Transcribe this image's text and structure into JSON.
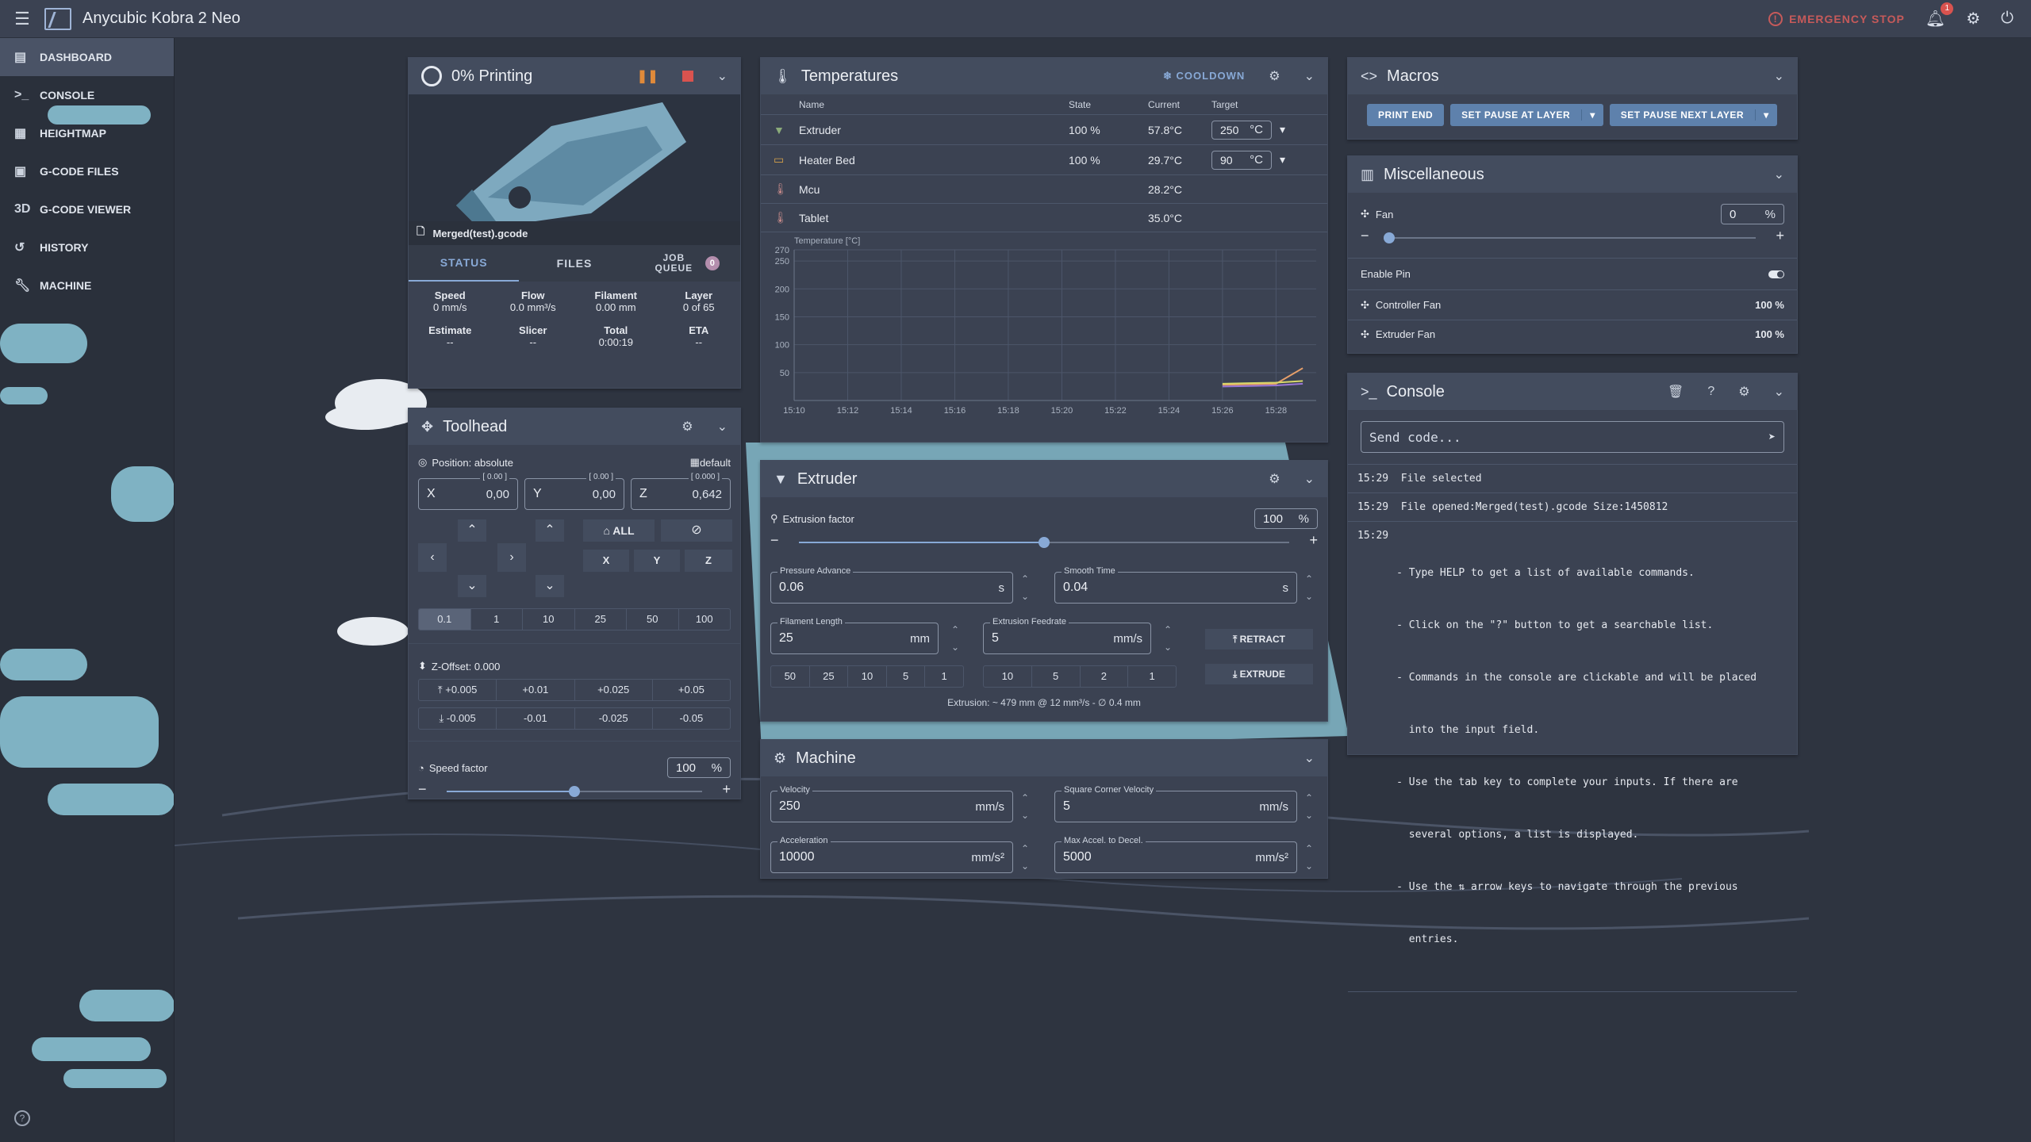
{
  "app": {
    "title": "Anycubic Kobra 2 Neo",
    "emergency": "EMERGENCY STOP",
    "notif_count": "1"
  },
  "nav": [
    {
      "label": "DASHBOARD",
      "icon": "dashboard-icon"
    },
    {
      "label": "CONSOLE",
      "icon": "console-icon"
    },
    {
      "label": "HEIGHTMAP",
      "icon": "grid-icon"
    },
    {
      "label": "G-CODE FILES",
      "icon": "files-icon"
    },
    {
      "label": "G-CODE VIEWER",
      "icon": "3d-icon",
      "glyph": "3D"
    },
    {
      "label": "HISTORY",
      "icon": "history-icon"
    },
    {
      "label": "MACHINE",
      "icon": "wrench-icon"
    }
  ],
  "status": {
    "title": "0% Printing",
    "filename": "Merged(test).gcode",
    "tabs": [
      "STATUS",
      "FILES",
      "JOB QUEUE"
    ],
    "queue_count": "0",
    "stats": [
      {
        "label": "Speed",
        "value": "0 mm/s"
      },
      {
        "label": "Flow",
        "value": "0.0 mm³/s"
      },
      {
        "label": "Filament",
        "value": "0.00 mm"
      },
      {
        "label": "Layer",
        "value": "0 of 65"
      },
      {
        "label": "Estimate",
        "value": "--"
      },
      {
        "label": "Slicer",
        "value": "--"
      },
      {
        "label": "Total",
        "value": "0:00:19"
      },
      {
        "label": "ETA",
        "value": "--"
      }
    ]
  },
  "toolhead": {
    "title": "Toolhead",
    "position_mode": "Position: absolute",
    "profile": "default",
    "axes": [
      {
        "axis": "X",
        "value": "0,00",
        "limit": "[ 0.00 ]"
      },
      {
        "axis": "Y",
        "value": "0,00",
        "limit": "[ 0.00 ]"
      },
      {
        "axis": "Z",
        "value": "0,642",
        "limit": "[ 0.000 ]"
      }
    ],
    "home_all": "ALL",
    "home_axes": [
      "X",
      "Y",
      "Z"
    ],
    "steps": [
      "0.1",
      "1",
      "10",
      "25",
      "50",
      "100"
    ],
    "zoffset": "Z-Offset: 0.000",
    "zup": [
      "+0.005",
      "+0.01",
      "+0.025",
      "+0.05"
    ],
    "zdown": [
      "-0.005",
      "-0.01",
      "-0.025",
      "-0.05"
    ],
    "speed_label": "Speed factor",
    "speed_value": "100",
    "speed_unit": "%",
    "speed_fraction": 0.5
  },
  "temps": {
    "title": "Temperatures",
    "cooldown": "COOLDOWN",
    "headers": [
      "Name",
      "State",
      "Current",
      "Target"
    ],
    "rows": [
      {
        "name": "Extruder",
        "state": "100 %",
        "current": "57.8°C",
        "target": "250",
        "unit": "°C"
      },
      {
        "name": "Heater Bed",
        "state": "100 %",
        "current": "29.7°C",
        "target": "90",
        "unit": "°C"
      },
      {
        "name": "Mcu",
        "state": "",
        "current": "28.2°C",
        "target": "",
        "unit": ""
      },
      {
        "name": "Tablet",
        "state": "",
        "current": "35.0°C",
        "target": "",
        "unit": ""
      }
    ]
  },
  "chart_data": {
    "type": "line",
    "ylabel": "Temperature [°C]",
    "ylim": [
      0,
      270
    ],
    "yticks": [
      50,
      100,
      150,
      200,
      250,
      270
    ],
    "xticks": [
      "15:10",
      "15:12",
      "15:14",
      "15:16",
      "15:18",
      "15:20",
      "15:22",
      "15:24",
      "15:26",
      "15:28"
    ],
    "grid": true,
    "series": [
      {
        "color": "#e8a06a",
        "x": [
          "15:26",
          "15:27",
          "15:28",
          "15:29"
        ],
        "values": [
          28,
          29,
          30,
          58
        ]
      },
      {
        "color": "#9a76d6",
        "x": [
          "15:26",
          "15:27",
          "15:28",
          "15:29"
        ],
        "values": [
          25,
          26,
          27,
          30
        ]
      },
      {
        "color": "#d8d86a",
        "x": [
          "15:26",
          "15:27",
          "15:28",
          "15:29"
        ],
        "values": [
          30,
          31,
          32,
          35
        ]
      }
    ]
  },
  "extruder": {
    "title": "Extruder",
    "factor_label": "Extrusion factor",
    "factor_value": "100",
    "factor_unit": "%",
    "factor_fraction": 0.5,
    "pa_label": "Pressure Advance",
    "pa_value": "0.06",
    "pa_unit": "s",
    "st_label": "Smooth Time",
    "st_value": "0.04",
    "st_unit": "s",
    "fl_label": "Filament Length",
    "fl_value": "25",
    "fl_unit": "mm",
    "ef_label": "Extrusion Feedrate",
    "ef_value": "5",
    "ef_unit": "mm/s",
    "len_steps": [
      "50",
      "25",
      "10",
      "5",
      "1"
    ],
    "feed_steps": [
      "10",
      "5",
      "2",
      "1"
    ],
    "retract": "RETRACT",
    "extrude": "EXTRUDE",
    "info": "Extrusion: ~ 479 mm @ 12 mm³/s - ∅ 0.4 mm"
  },
  "machine": {
    "title": "Machine",
    "vel_label": "Velocity",
    "vel_value": "250",
    "vel_unit": "mm/s",
    "scv_label": "Square Corner Velocity",
    "scv_value": "5",
    "scv_unit": "mm/s",
    "acc_label": "Acceleration",
    "acc_value": "10000",
    "acc_unit": "mm/s²",
    "mad_label": "Max Accel. to Decel.",
    "mad_value": "5000",
    "mad_unit": "mm/s²"
  },
  "macros": {
    "title": "Macros",
    "buttons": [
      "PRINT END",
      "SET PAUSE AT LAYER",
      "SET PAUSE NEXT LAYER"
    ]
  },
  "misc": {
    "title": "Miscellaneous",
    "fan_label": "Fan",
    "fan_value": "0",
    "fan_unit": "%",
    "fan_fraction": 0.0,
    "enable_pin": "Enable Pin",
    "controller_fan": "Controller Fan",
    "controller_value": "100 %",
    "extruder_fan": "Extruder Fan",
    "extruder_value": "100 %"
  },
  "console": {
    "title": "Console",
    "placeholder": "Send code...",
    "lines": [
      {
        "time": "15:29",
        "text": "File selected"
      },
      {
        "time": "15:29",
        "text": "File opened:Merged(test).gcode Size:1450812"
      }
    ],
    "help_time": "15:29",
    "help_lines": [
      "- Type HELP to get a list of available commands.",
      "- Click on the \"?\" button to get a searchable list.",
      "- Commands in the console are clickable and will be placed",
      "  into the input field.",
      "- Use the tab key to complete your inputs. If there are",
      "  several options, a list is displayed.",
      "- Use the ⇅ arrow keys to navigate through the previous",
      "  entries."
    ]
  }
}
